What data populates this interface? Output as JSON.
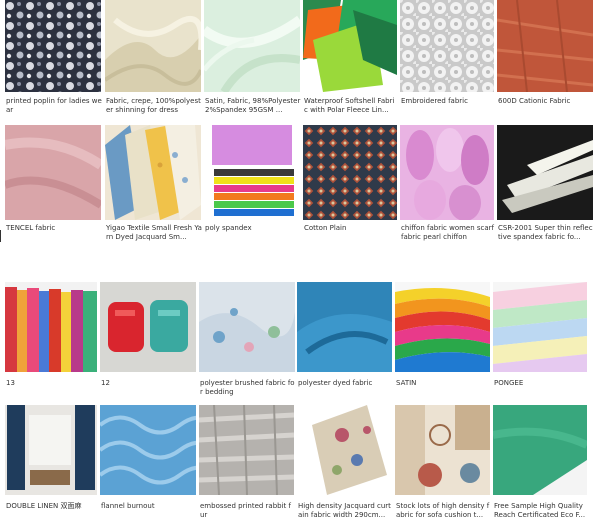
{
  "products": [
    {
      "caption": "printed poplin for ladies wear",
      "image": "floral-print-fabric"
    },
    {
      "caption": "Fabric, crepe, 100%polyester shinning for dress",
      "image": "cream-draped-fabric"
    },
    {
      "caption": "Satin, Fabric, 98%Polyester 2%Spandex 95GSM ...",
      "image": "mint-satin-fabric"
    },
    {
      "caption": "Waterproof Softshell Fabric with Polar Fleece Lin...",
      "image": "softshell-swatches"
    },
    {
      "caption": "Embroidered fabric",
      "image": "white-embroidered-lace"
    },
    {
      "caption": "600D Cationic Fabric",
      "image": "rust-cationic-fabric"
    },
    {
      "caption": "TENCEL fabric",
      "image": "pink-tencel-fabric"
    },
    {
      "caption": "Yigao Textile Small Fresh Yarn Dyed Jacquard Sm...",
      "image": "jacquard-swatches"
    },
    {
      "caption": "poly spandex",
      "image": "stacked-color-fabric"
    },
    {
      "caption": "Cotton Plain",
      "image": "geometric-print-fabric"
    },
    {
      "caption": "chiffon fabric women scarf fabric pearl chiffon",
      "image": "pink-chiffon-rolls"
    },
    {
      "caption": "CSR-2001 Super thin reflective spandex fabric fo...",
      "image": "reflective-fabric"
    },
    {
      "caption": "13",
      "image": "colorful-fabric-rack"
    },
    {
      "caption": "12",
      "image": "red-teal-cushions"
    },
    {
      "caption": "polyester brushed fabric for bedding",
      "image": "floral-bedding-fabric"
    },
    {
      "caption": "polyester dyed fabric",
      "image": "blue-dyed-fabric"
    },
    {
      "caption": "SATIN",
      "image": "rainbow-satin-fabric"
    },
    {
      "caption": "PONGEE",
      "image": "pastel-pongee-fabric"
    },
    {
      "caption": "DOUBLE LINEN 双面麻",
      "image": "curtain-room"
    },
    {
      "caption": "flannel burnout",
      "image": "blue-flannel-burnout"
    },
    {
      "caption": "embossed printed rabbit fur",
      "image": "grey-rabbit-fur"
    },
    {
      "caption": "High density Jacquard curtain fabric width 290cm...",
      "image": "jacquard-curtain-fabric"
    },
    {
      "caption": "Stock lots of high density fabric for sofa cushion t...",
      "image": "sofa-fabric-samples"
    },
    {
      "caption": "Free Sample High Quality Reach Certificated Eco F...",
      "image": "green-fabric-sheet"
    }
  ],
  "colors": {
    "caption": "#333333",
    "background": "#ffffff"
  }
}
